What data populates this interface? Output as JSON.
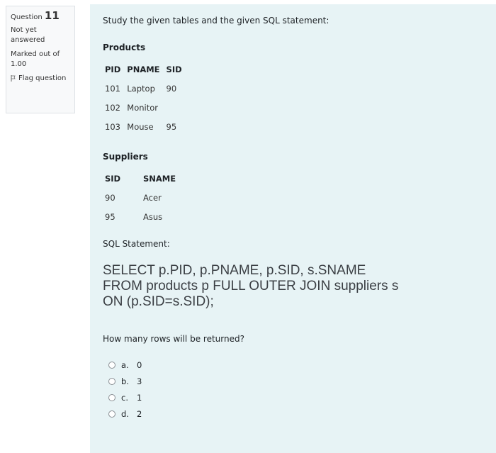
{
  "info": {
    "question_prefix": "Question",
    "question_number": "11",
    "status": "Not yet answered",
    "marks": "Marked out of 1.00",
    "flag_label": "Flag question"
  },
  "content": {
    "prompt": "Study the given tables and the given SQL statement:",
    "products": {
      "title": "Products",
      "headers": [
        "PID",
        "PNAME",
        "SID"
      ],
      "rows": [
        [
          "101",
          "Laptop",
          "90"
        ],
        [
          "102",
          "Monitor",
          ""
        ],
        [
          "103",
          "Mouse",
          "95"
        ]
      ]
    },
    "suppliers": {
      "title": "Suppliers",
      "headers": [
        "SID",
        "SNAME"
      ],
      "rows": [
        [
          "90",
          "Acer"
        ],
        [
          "95",
          "Asus"
        ]
      ]
    },
    "sql_label": "SQL Statement:",
    "sql_lines": [
      "SELECT p.PID, p.PNAME, p.SID, s.SNAME",
      "FROM products p FULL OUTER JOIN suppliers s",
      "ON (p.SID=s.SID);"
    ],
    "question": "How many rows will be returned?",
    "options": [
      {
        "letter": "a.",
        "value": "0"
      },
      {
        "letter": "b.",
        "value": "3"
      },
      {
        "letter": "c.",
        "value": "1"
      },
      {
        "letter": "d.",
        "value": "2"
      }
    ]
  }
}
